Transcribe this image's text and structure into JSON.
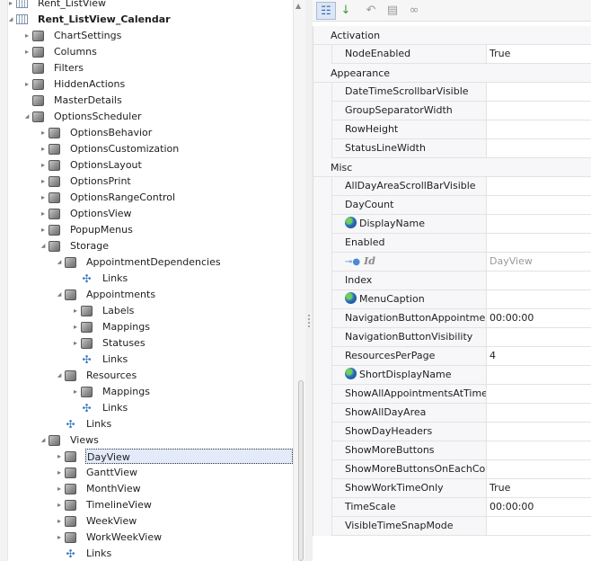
{
  "tree": [
    {
      "label": "Rent_ListView",
      "level": 0,
      "exp": "collapsed",
      "icon": "listview"
    },
    {
      "label": "Rent_ListView_Calendar",
      "level": 0,
      "exp": "expanded",
      "icon": "listview",
      "bold": true
    },
    {
      "label": "ChartSettings",
      "level": 1,
      "exp": "collapsed",
      "icon": "node"
    },
    {
      "label": "Columns",
      "level": 1,
      "exp": "collapsed",
      "icon": "node"
    },
    {
      "label": "Filters",
      "level": 1,
      "exp": "none",
      "icon": "node"
    },
    {
      "label": "HiddenActions",
      "level": 1,
      "exp": "collapsed",
      "icon": "node"
    },
    {
      "label": "MasterDetails",
      "level": 1,
      "exp": "none",
      "icon": "node"
    },
    {
      "label": "OptionsScheduler",
      "level": 1,
      "exp": "expanded",
      "icon": "node"
    },
    {
      "label": "OptionsBehavior",
      "level": 2,
      "exp": "collapsed",
      "icon": "node"
    },
    {
      "label": "OptionsCustomization",
      "level": 2,
      "exp": "collapsed",
      "icon": "node"
    },
    {
      "label": "OptionsLayout",
      "level": 2,
      "exp": "collapsed",
      "icon": "node"
    },
    {
      "label": "OptionsPrint",
      "level": 2,
      "exp": "collapsed",
      "icon": "node"
    },
    {
      "label": "OptionsRangeControl",
      "level": 2,
      "exp": "collapsed",
      "icon": "node"
    },
    {
      "label": "OptionsView",
      "level": 2,
      "exp": "collapsed",
      "icon": "node"
    },
    {
      "label": "PopupMenus",
      "level": 2,
      "exp": "collapsed",
      "icon": "node"
    },
    {
      "label": "Storage",
      "level": 2,
      "exp": "expanded",
      "icon": "node"
    },
    {
      "label": "AppointmentDependencies",
      "level": 3,
      "exp": "expanded",
      "icon": "node"
    },
    {
      "label": "Links",
      "level": 4,
      "exp": "none",
      "icon": "links"
    },
    {
      "label": "Appointments",
      "level": 3,
      "exp": "expanded",
      "icon": "node"
    },
    {
      "label": "Labels",
      "level": 4,
      "exp": "collapsed",
      "icon": "node"
    },
    {
      "label": "Mappings",
      "level": 4,
      "exp": "collapsed",
      "icon": "node"
    },
    {
      "label": "Statuses",
      "level": 4,
      "exp": "collapsed",
      "icon": "node"
    },
    {
      "label": "Links",
      "level": 4,
      "exp": "none",
      "icon": "links"
    },
    {
      "label": "Resources",
      "level": 3,
      "exp": "expanded",
      "icon": "node"
    },
    {
      "label": "Mappings",
      "level": 4,
      "exp": "collapsed",
      "icon": "node"
    },
    {
      "label": "Links",
      "level": 4,
      "exp": "none",
      "icon": "links"
    },
    {
      "label": "Links",
      "level": 3,
      "exp": "none",
      "icon": "links"
    },
    {
      "label": "Views",
      "level": 2,
      "exp": "expanded",
      "icon": "node"
    },
    {
      "label": "DayView",
      "level": 3,
      "exp": "collapsed",
      "icon": "node",
      "selected": true
    },
    {
      "label": "GanttView",
      "level": 3,
      "exp": "collapsed",
      "icon": "node"
    },
    {
      "label": "MonthView",
      "level": 3,
      "exp": "collapsed",
      "icon": "node"
    },
    {
      "label": "TimelineView",
      "level": 3,
      "exp": "collapsed",
      "icon": "node"
    },
    {
      "label": "WeekView",
      "level": 3,
      "exp": "collapsed",
      "icon": "node"
    },
    {
      "label": "WorkWeekView",
      "level": 3,
      "exp": "collapsed",
      "icon": "node"
    },
    {
      "label": "Links",
      "level": 3,
      "exp": "none",
      "icon": "links"
    }
  ],
  "toolbar": [
    {
      "name": "categorized-button",
      "icon": "categorized-icon",
      "glyph": "☷",
      "active": true
    },
    {
      "name": "alphabetical-button",
      "icon": "sort-az-icon",
      "glyph": "↓",
      "active": false
    },
    {
      "name": "undo-button",
      "icon": "undo-icon",
      "glyph": "↶",
      "active": false
    },
    {
      "name": "properties-button",
      "icon": "properties-icon",
      "glyph": "▤",
      "active": false
    },
    {
      "name": "link-button",
      "icon": "link-icon",
      "glyph": "∞",
      "active": false
    }
  ],
  "properties": [
    {
      "category": "Activation",
      "rows": [
        {
          "name": "NodeEnabled",
          "value": "True"
        }
      ]
    },
    {
      "category": "Appearance",
      "rows": [
        {
          "name": "DateTimeScrollbarVisible",
          "value": ""
        },
        {
          "name": "GroupSeparatorWidth",
          "value": ""
        },
        {
          "name": "RowHeight",
          "value": ""
        },
        {
          "name": "StatusLineWidth",
          "value": ""
        }
      ]
    },
    {
      "category": "Misc",
      "rows": [
        {
          "name": "AllDayAreaScrollBarVisible",
          "value": ""
        },
        {
          "name": "DayCount",
          "value": ""
        },
        {
          "name": "DisplayName",
          "value": "",
          "icon": "globe"
        },
        {
          "name": "Enabled",
          "value": ""
        },
        {
          "name": "Id",
          "value": "DayView",
          "icon": "key",
          "readonly": true
        },
        {
          "name": "Index",
          "value": ""
        },
        {
          "name": "MenuCaption",
          "value": "",
          "icon": "globe"
        },
        {
          "name": "NavigationButtonAppointmentSearchInterval",
          "value": "00:00:00"
        },
        {
          "name": "NavigationButtonVisibility",
          "value": ""
        },
        {
          "name": "ResourcesPerPage",
          "value": "4"
        },
        {
          "name": "ShortDisplayName",
          "value": "",
          "icon": "globe"
        },
        {
          "name": "ShowAllAppointmentsAtTimeCells",
          "value": ""
        },
        {
          "name": "ShowAllDayArea",
          "value": ""
        },
        {
          "name": "ShowDayHeaders",
          "value": ""
        },
        {
          "name": "ShowMoreButtons",
          "value": ""
        },
        {
          "name": "ShowMoreButtonsOnEachColumn",
          "value": ""
        },
        {
          "name": "ShowWorkTimeOnly",
          "value": "True"
        },
        {
          "name": "TimeScale",
          "value": "00:00:00"
        },
        {
          "name": "VisibleTimeSnapMode",
          "value": ""
        }
      ]
    }
  ]
}
